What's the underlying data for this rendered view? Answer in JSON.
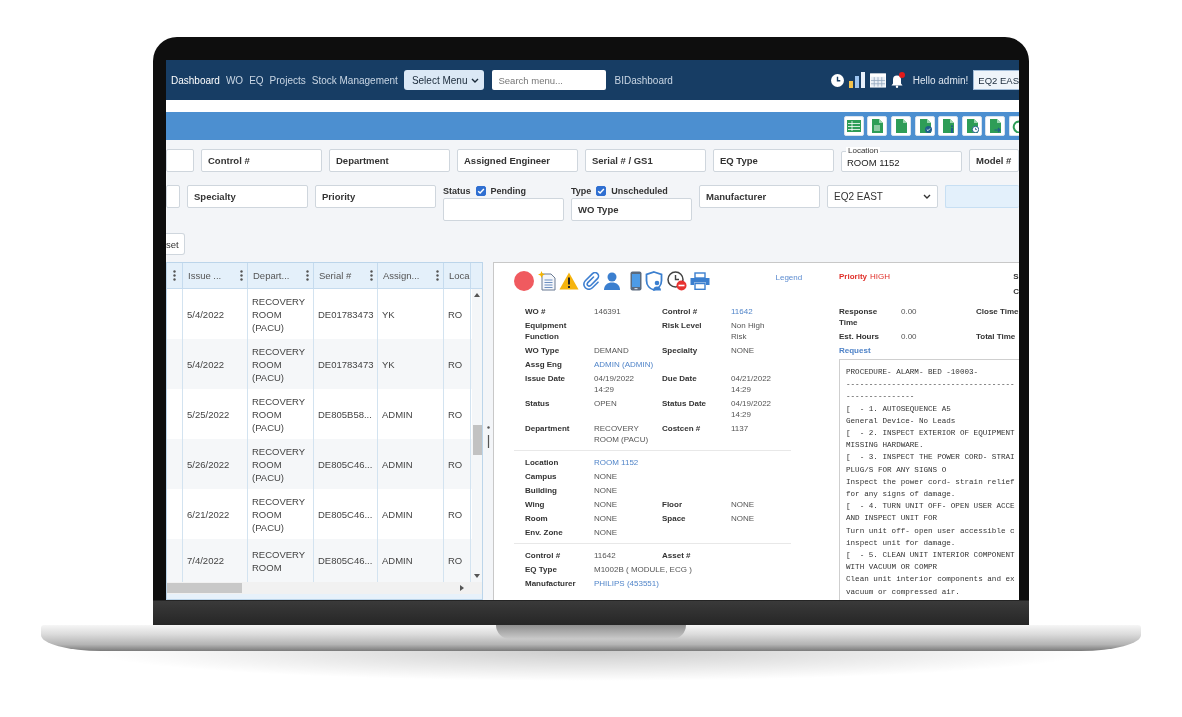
{
  "nav": {
    "links": [
      {
        "label": "Dashboard",
        "selected": true
      },
      {
        "label": "WO",
        "selected": false
      },
      {
        "label": "EQ",
        "selected": false
      },
      {
        "label": "Projects",
        "selected": false
      },
      {
        "label": "Stock Management",
        "selected": false
      }
    ],
    "menu_select": "Select Menu",
    "search": {
      "placeholder": "Search menu..."
    },
    "bi_link": "BIDashboard",
    "notifications": true,
    "greeting": "Hello admin!",
    "site": "EQ2 EAS"
  },
  "filters": {
    "rows": [
      [
        {
          "kind": "input"
        },
        {
          "kind": "input",
          "placeholder": "Control #"
        },
        {
          "kind": "input",
          "placeholder": "Department"
        },
        {
          "kind": "input",
          "placeholder": "Assigned Engineer"
        },
        {
          "kind": "input",
          "placeholder": "Serial # / GS1"
        },
        {
          "kind": "input",
          "placeholder": "EQ Type"
        },
        {
          "kind": "floating",
          "label": "Location",
          "value": "ROOM 1152"
        },
        {
          "kind": "input",
          "placeholder": "Model #"
        }
      ],
      [
        {
          "kind": "input"
        },
        {
          "kind": "input",
          "placeholder": "Specialty"
        },
        {
          "kind": "input",
          "placeholder": "Priority"
        },
        {
          "kind": "check_input",
          "label": "Status",
          "option": "Pending",
          "checked": true
        },
        {
          "kind": "check_input",
          "label": "Type",
          "option": "Unscheduled",
          "checked": true,
          "placeholder": "WO Type"
        },
        {
          "kind": "input",
          "placeholder": "Manufacturer"
        },
        {
          "kind": "select",
          "value": "EQ2 EAST"
        },
        {
          "kind": "tinted"
        }
      ]
    ],
    "reset_button": "set"
  },
  "table": {
    "lead_column": {
      "menu": true
    },
    "columns": [
      {
        "label": "Issue ...",
        "menu": true
      },
      {
        "label": "Depart...",
        "menu": true
      },
      {
        "label": "Serial #",
        "menu": true
      },
      {
        "label": "Assign...",
        "menu": true
      },
      {
        "label": "Loca",
        "menu": false
      }
    ],
    "rows": [
      {
        "cells": [
          "5/4/2022",
          "RECOVERY ROOM (PACU)",
          "DE01783473",
          "YK",
          "RO"
        ]
      },
      {
        "cells": [
          "5/4/2022",
          "RECOVERY ROOM (PACU)",
          "DE01783473",
          "YK",
          "RO"
        ]
      },
      {
        "cells": [
          "5/25/2022",
          "RECOVERY ROOM (PACU)",
          "DE805B58...",
          "ADMIN",
          "RO"
        ]
      },
      {
        "cells": [
          "5/26/2022",
          "RECOVERY ROOM (PACU)",
          "DE805C46...",
          "ADMIN",
          "RO"
        ]
      },
      {
        "cells": [
          "6/21/2022",
          "RECOVERY ROOM (PACU)",
          "DE805C46...",
          "ADMIN",
          "RO"
        ]
      },
      {
        "cells": [
          "7/4/2022",
          "RECOVERY ROOM",
          "DE805C46...",
          "ADMIN",
          "RO"
        ]
      }
    ]
  },
  "detail": {
    "legend": "Legend",
    "priority": {
      "label": "Priority",
      "value": "HIGH"
    },
    "edge_labels": [
      "S",
      "C"
    ],
    "sections": [
      {
        "rows": [
          {
            "fields": [
              {
                "label": "WO #",
                "value": "146391"
              },
              {
                "label": "Control #",
                "value": "11642",
                "link": true
              }
            ]
          },
          {
            "fields": [
              {
                "label": "Equipment Function"
              },
              {
                "label": "Risk Level",
                "value": "Non High Risk"
              }
            ]
          },
          {
            "fields": [
              {
                "label": "WO Type",
                "value": "DEMAND"
              },
              {
                "label": "Specialty",
                "value": "NONE"
              }
            ]
          },
          {
            "fields": [
              {
                "label": "Assg Eng",
                "value": "ADMIN (ADMIN)",
                "link": true
              }
            ]
          },
          {
            "fields": [
              {
                "label": "Issue Date",
                "value": "04/19/2022 14:29"
              },
              {
                "label": "Due Date",
                "value": "04/21/2022 14:29"
              }
            ]
          },
          {
            "fields": [
              {
                "label": "Status",
                "value": "OPEN"
              },
              {
                "label": "Status Date",
                "value": "04/19/2022 14:29"
              }
            ]
          },
          {
            "fields": [
              {
                "label": "Department",
                "value": "RECOVERY ROOM (PACU)"
              },
              {
                "label": "Costcen #",
                "value": "1137"
              }
            ]
          }
        ]
      },
      {
        "rows": [
          {
            "fields": [
              {
                "label": "Location",
                "value": "ROOM 1152",
                "link": true
              }
            ]
          },
          {
            "fields": [
              {
                "label": "Campus",
                "value": "NONE"
              }
            ]
          },
          {
            "fields": [
              {
                "label": "Building",
                "value": "NONE"
              }
            ]
          },
          {
            "fields": [
              {
                "label": "Wing",
                "value": "NONE"
              },
              {
                "label": "Floor",
                "value": "NONE"
              }
            ]
          },
          {
            "fields": [
              {
                "label": "Room",
                "value": "NONE"
              },
              {
                "label": "Space",
                "value": "NONE"
              }
            ]
          },
          {
            "fields": [
              {
                "label": "Env. Zone",
                "value": "NONE"
              }
            ]
          }
        ]
      },
      {
        "rows": [
          {
            "fields": [
              {
                "label": "Control #",
                "value": "11642"
              },
              {
                "label": "Asset #"
              }
            ]
          },
          {
            "fields": [
              {
                "label": "EQ Type",
                "value": "M1002B ( MODULE, ECG )"
              }
            ]
          },
          {
            "fields": [
              {
                "label": "Manufacturer",
                "value": "PHILIPS (453551)",
                "link": true
              }
            ]
          }
        ]
      }
    ],
    "times": [
      {
        "fields": [
          {
            "label": "Response Time",
            "value": "0.00"
          },
          {
            "label": "Close Time"
          }
        ]
      },
      {
        "fields": [
          {
            "label": "Est. Hours",
            "value": "0.00"
          },
          {
            "label": "Total Time"
          }
        ]
      }
    ],
    "request": {
      "label": "Request",
      "lines": [
        "PROCEDURE- ALARM- BED -10003-",
        "-------------------------------------",
        "---------------",
        "[  - 1. AUTOSEQUENCE A5",
        "General Device- No Leads",
        "[  - 2. INSPECT EXTERIOR OF EQUIPMENT",
        "MISSING HARDWARE.",
        "[  - 3. INSPECT THE POWER CORD- STRAI",
        "PLUG/S FOR ANY SIGNS O",
        "Inspect the power cord- strain relief",
        "for any signs of damage.",
        "[  - 4. TURN UNIT OFF- OPEN USER ACCE",
        "AND INSPECT UNIT FOR",
        "Turn unit off- open user accessible c",
        "inspect unit for damage.",
        "[  - 5. CLEAN UNIT INTERIOR COMPONENT",
        "WITH VACUUM OR COMPR",
        "Clean unit interior components and ex",
        "vacuum or compressed air."
      ]
    }
  }
}
